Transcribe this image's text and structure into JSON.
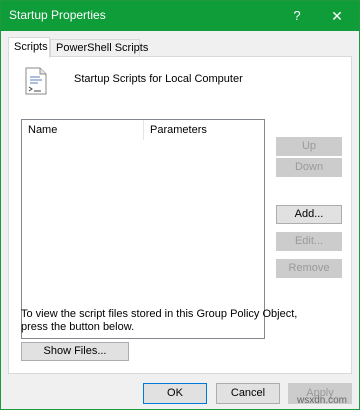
{
  "window": {
    "title": "Startup Properties",
    "help": "?",
    "close": "✕"
  },
  "tabs": [
    {
      "label": "Scripts",
      "active": true
    },
    {
      "label": "PowerShell Scripts",
      "active": false
    }
  ],
  "panel": {
    "heading": "Startup Scripts for Local Computer",
    "list": {
      "columns": [
        "Name",
        "Parameters"
      ],
      "rows": []
    },
    "buttons": {
      "up": "Up",
      "down": "Down",
      "add": "Add...",
      "edit": "Edit...",
      "remove": "Remove",
      "show_files": "Show Files..."
    },
    "info": "To view the script files stored in this Group Policy Object, press the button below."
  },
  "footer": {
    "ok": "OK",
    "cancel": "Cancel",
    "apply": "Apply"
  },
  "watermark": "wsxdn.com"
}
